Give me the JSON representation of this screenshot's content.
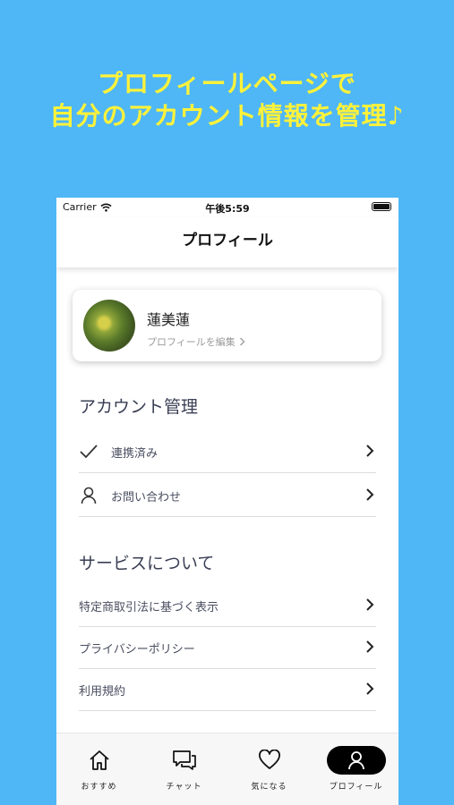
{
  "headline": {
    "line1": "プロフィールページで",
    "line2": "自分のアカウント情報を管理♪"
  },
  "status_bar": {
    "carrier": "Carrier",
    "time": "午後5:59"
  },
  "nav": {
    "title": "プロフィール"
  },
  "profile": {
    "name": "蓮美蓮",
    "edit_label": "プロフィールを編集"
  },
  "sections": {
    "account": {
      "title": "アカウント管理",
      "items": [
        {
          "label": "連携済み",
          "icon": "check-icon"
        },
        {
          "label": "お問い合わせ",
          "icon": "person-icon"
        }
      ]
    },
    "service": {
      "title": "サービスについて",
      "items": [
        {
          "label": "特定商取引法に基づく表示"
        },
        {
          "label": "プライバシーポリシー"
        },
        {
          "label": "利用規約"
        }
      ]
    }
  },
  "tabbar": {
    "tabs": [
      {
        "label": "おすすめ",
        "icon": "home-icon"
      },
      {
        "label": "チャット",
        "icon": "chat-icon"
      },
      {
        "label": "気になる",
        "icon": "heart-icon"
      },
      {
        "label": "プロフィール",
        "icon": "person-icon",
        "active": true
      }
    ]
  },
  "colors": {
    "background": "#4fb7f5",
    "headline": "#fff23a",
    "active_tab": "#000000"
  }
}
